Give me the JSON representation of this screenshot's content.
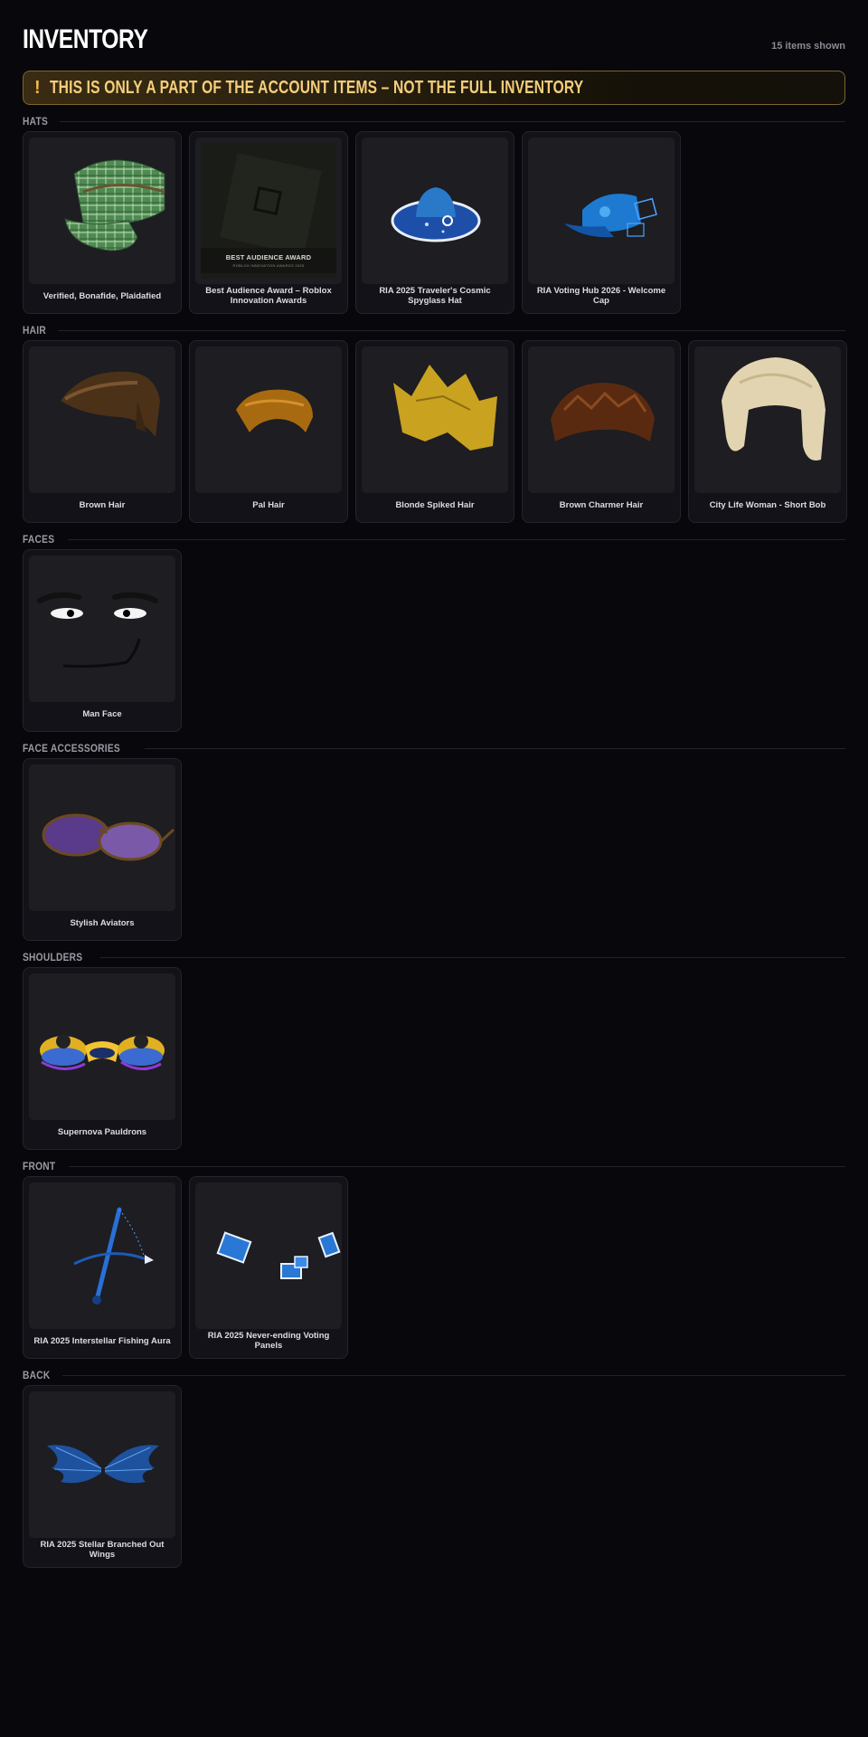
{
  "header": {
    "title": "INVENTORY",
    "count": "15 items shown"
  },
  "banner": {
    "icon": "!",
    "text": "THIS IS ONLY A PART OF THE ACCOUNT ITEMS – NOT THE FULL INVENTORY"
  },
  "sections": [
    {
      "title": "HATS",
      "items": [
        {
          "name": "Verified, Bonafide, Plaidafied",
          "icon": "plaid-cap-icon"
        },
        {
          "name": "Best Audience Award – Roblox Innovation Awards",
          "icon": "award-plaque-icon",
          "award_line1": "BEST AUDIENCE AWARD",
          "award_line2": "ROBLOX INNOVATION AWARDS 2025"
        },
        {
          "name": "RIA 2025 Traveler's Cosmic Spyglass Hat",
          "icon": "cosmic-hat-icon"
        },
        {
          "name": "RIA Voting Hub 2026 - Welcome Cap",
          "icon": "holo-cap-icon"
        }
      ]
    },
    {
      "title": "HAIR",
      "items": [
        {
          "name": "Brown Hair",
          "icon": "brown-hair-icon"
        },
        {
          "name": "Pal Hair",
          "icon": "pal-hair-icon"
        },
        {
          "name": "Blonde Spiked Hair",
          "icon": "spiked-hair-icon"
        },
        {
          "name": "Brown Charmer Hair",
          "icon": "charmer-hair-icon"
        },
        {
          "name": "City Life Woman - Short Bob",
          "icon": "bob-hair-icon"
        }
      ]
    },
    {
      "title": "FACES",
      "items": [
        {
          "name": "Man Face",
          "icon": "man-face-icon"
        }
      ]
    },
    {
      "title": "FACE ACCESSORIES",
      "items": [
        {
          "name": "Stylish Aviators",
          "icon": "aviators-icon"
        }
      ]
    },
    {
      "title": "SHOULDERS",
      "items": [
        {
          "name": "Supernova Pauldrons",
          "icon": "pauldrons-icon"
        }
      ]
    },
    {
      "title": "FRONT",
      "items": [
        {
          "name": "RIA 2025 Interstellar Fishing Aura",
          "icon": "fishing-aura-icon"
        },
        {
          "name": "RIA 2025 Never-ending Voting Panels",
          "icon": "voting-panels-icon"
        }
      ]
    },
    {
      "title": "BACK",
      "items": [
        {
          "name": "RIA 2025 Stellar Branched Out Wings",
          "icon": "stellar-wings-icon"
        }
      ]
    }
  ]
}
